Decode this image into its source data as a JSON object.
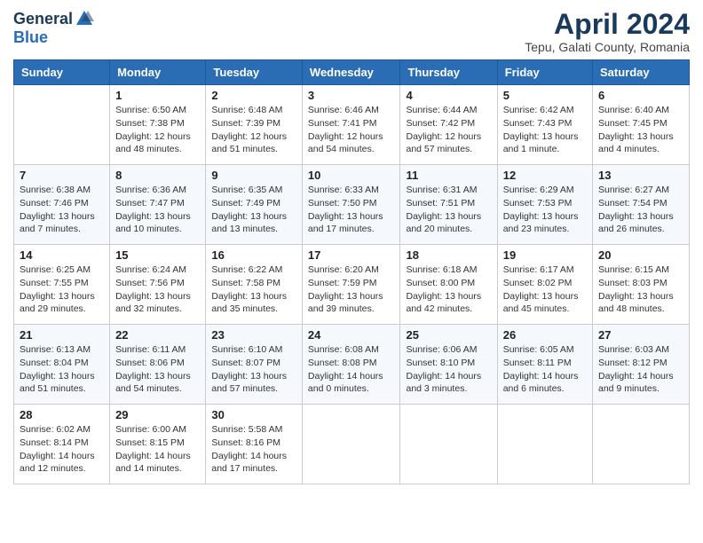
{
  "header": {
    "logo_general": "General",
    "logo_blue": "Blue",
    "month_title": "April 2024",
    "location": "Tepu, Galati County, Romania"
  },
  "days_of_week": [
    "Sunday",
    "Monday",
    "Tuesday",
    "Wednesday",
    "Thursday",
    "Friday",
    "Saturday"
  ],
  "weeks": [
    [
      {
        "day": "",
        "info": ""
      },
      {
        "day": "1",
        "info": "Sunrise: 6:50 AM\nSunset: 7:38 PM\nDaylight: 12 hours\nand 48 minutes."
      },
      {
        "day": "2",
        "info": "Sunrise: 6:48 AM\nSunset: 7:39 PM\nDaylight: 12 hours\nand 51 minutes."
      },
      {
        "day": "3",
        "info": "Sunrise: 6:46 AM\nSunset: 7:41 PM\nDaylight: 12 hours\nand 54 minutes."
      },
      {
        "day": "4",
        "info": "Sunrise: 6:44 AM\nSunset: 7:42 PM\nDaylight: 12 hours\nand 57 minutes."
      },
      {
        "day": "5",
        "info": "Sunrise: 6:42 AM\nSunset: 7:43 PM\nDaylight: 13 hours\nand 1 minute."
      },
      {
        "day": "6",
        "info": "Sunrise: 6:40 AM\nSunset: 7:45 PM\nDaylight: 13 hours\nand 4 minutes."
      }
    ],
    [
      {
        "day": "7",
        "info": "Sunrise: 6:38 AM\nSunset: 7:46 PM\nDaylight: 13 hours\nand 7 minutes."
      },
      {
        "day": "8",
        "info": "Sunrise: 6:36 AM\nSunset: 7:47 PM\nDaylight: 13 hours\nand 10 minutes."
      },
      {
        "day": "9",
        "info": "Sunrise: 6:35 AM\nSunset: 7:49 PM\nDaylight: 13 hours\nand 13 minutes."
      },
      {
        "day": "10",
        "info": "Sunrise: 6:33 AM\nSunset: 7:50 PM\nDaylight: 13 hours\nand 17 minutes."
      },
      {
        "day": "11",
        "info": "Sunrise: 6:31 AM\nSunset: 7:51 PM\nDaylight: 13 hours\nand 20 minutes."
      },
      {
        "day": "12",
        "info": "Sunrise: 6:29 AM\nSunset: 7:53 PM\nDaylight: 13 hours\nand 23 minutes."
      },
      {
        "day": "13",
        "info": "Sunrise: 6:27 AM\nSunset: 7:54 PM\nDaylight: 13 hours\nand 26 minutes."
      }
    ],
    [
      {
        "day": "14",
        "info": "Sunrise: 6:25 AM\nSunset: 7:55 PM\nDaylight: 13 hours\nand 29 minutes."
      },
      {
        "day": "15",
        "info": "Sunrise: 6:24 AM\nSunset: 7:56 PM\nDaylight: 13 hours\nand 32 minutes."
      },
      {
        "day": "16",
        "info": "Sunrise: 6:22 AM\nSunset: 7:58 PM\nDaylight: 13 hours\nand 35 minutes."
      },
      {
        "day": "17",
        "info": "Sunrise: 6:20 AM\nSunset: 7:59 PM\nDaylight: 13 hours\nand 39 minutes."
      },
      {
        "day": "18",
        "info": "Sunrise: 6:18 AM\nSunset: 8:00 PM\nDaylight: 13 hours\nand 42 minutes."
      },
      {
        "day": "19",
        "info": "Sunrise: 6:17 AM\nSunset: 8:02 PM\nDaylight: 13 hours\nand 45 minutes."
      },
      {
        "day": "20",
        "info": "Sunrise: 6:15 AM\nSunset: 8:03 PM\nDaylight: 13 hours\nand 48 minutes."
      }
    ],
    [
      {
        "day": "21",
        "info": "Sunrise: 6:13 AM\nSunset: 8:04 PM\nDaylight: 13 hours\nand 51 minutes."
      },
      {
        "day": "22",
        "info": "Sunrise: 6:11 AM\nSunset: 8:06 PM\nDaylight: 13 hours\nand 54 minutes."
      },
      {
        "day": "23",
        "info": "Sunrise: 6:10 AM\nSunset: 8:07 PM\nDaylight: 13 hours\nand 57 minutes."
      },
      {
        "day": "24",
        "info": "Sunrise: 6:08 AM\nSunset: 8:08 PM\nDaylight: 14 hours\nand 0 minutes."
      },
      {
        "day": "25",
        "info": "Sunrise: 6:06 AM\nSunset: 8:10 PM\nDaylight: 14 hours\nand 3 minutes."
      },
      {
        "day": "26",
        "info": "Sunrise: 6:05 AM\nSunset: 8:11 PM\nDaylight: 14 hours\nand 6 minutes."
      },
      {
        "day": "27",
        "info": "Sunrise: 6:03 AM\nSunset: 8:12 PM\nDaylight: 14 hours\nand 9 minutes."
      }
    ],
    [
      {
        "day": "28",
        "info": "Sunrise: 6:02 AM\nSunset: 8:14 PM\nDaylight: 14 hours\nand 12 minutes."
      },
      {
        "day": "29",
        "info": "Sunrise: 6:00 AM\nSunset: 8:15 PM\nDaylight: 14 hours\nand 14 minutes."
      },
      {
        "day": "30",
        "info": "Sunrise: 5:58 AM\nSunset: 8:16 PM\nDaylight: 14 hours\nand 17 minutes."
      },
      {
        "day": "",
        "info": ""
      },
      {
        "day": "",
        "info": ""
      },
      {
        "day": "",
        "info": ""
      },
      {
        "day": "",
        "info": ""
      }
    ]
  ]
}
